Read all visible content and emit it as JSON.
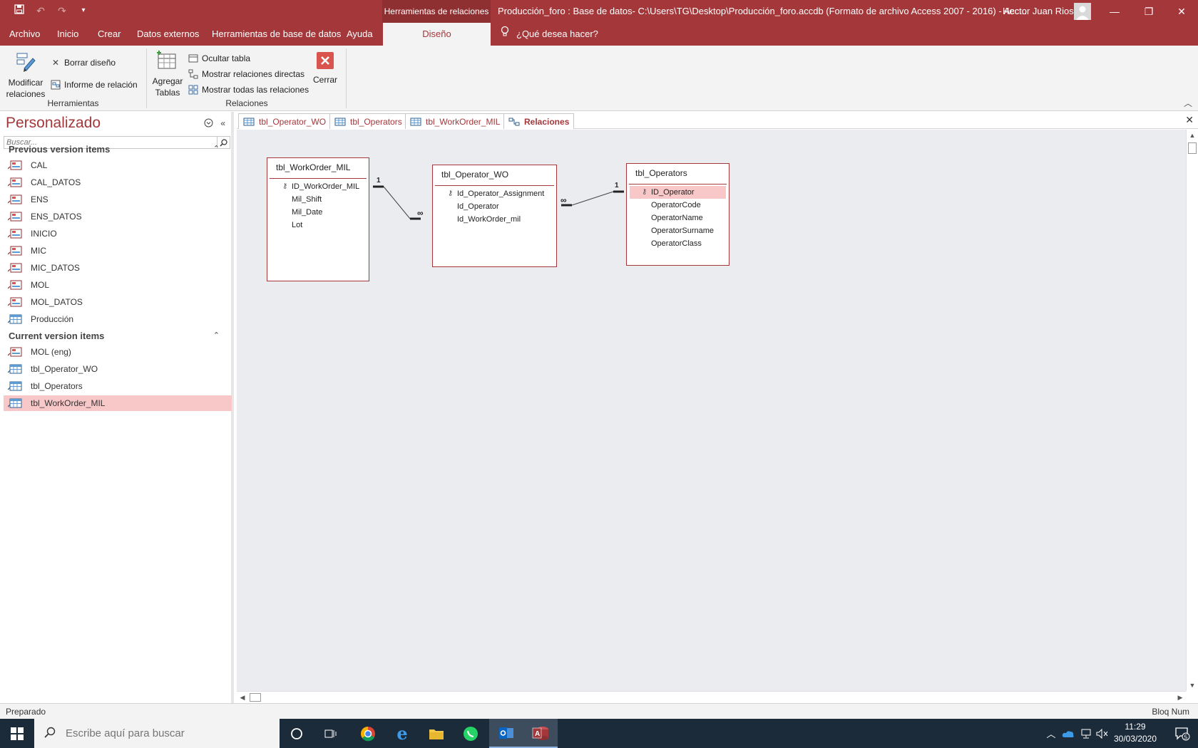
{
  "window": {
    "doc_title": "Producción_foro : Base de datos- C:\\Users\\TG\\Desktop\\Producción_foro.accdb (Formato de archivo Access 2007 - 2016)  -  Acc...",
    "context_tab_title": "Herramientas de relaciones",
    "user_name": "Hector Juan Rios",
    "accent_color": "#a4373a"
  },
  "ribbon_tabs": [
    "Archivo",
    "Inicio",
    "Crear",
    "Datos externos",
    "Herramientas de base de datos",
    "Ayuda",
    "Diseño"
  ],
  "tell_me": "¿Qué desea hacer?",
  "ribbon": {
    "herramientas": {
      "label": "Herramientas",
      "modificar_line1": "Modificar",
      "modificar_line2": "relaciones",
      "borrar": "Borrar diseño",
      "informe": "Informe de relación"
    },
    "relaciones": {
      "label": "Relaciones",
      "agregar_line1": "Agregar",
      "agregar_line2": "Tablas",
      "ocultar": "Ocultar tabla",
      "mostrar_directas": "Mostrar relaciones directas",
      "mostrar_todas": "Mostrar todas las relaciones",
      "cerrar": "Cerrar"
    }
  },
  "nav": {
    "title": "Personalizado",
    "search_placeholder": "Buscar...",
    "sections": [
      {
        "title": "Previous version items",
        "items": [
          {
            "label": "CAL",
            "type": "form"
          },
          {
            "label": "CAL_DATOS",
            "type": "form"
          },
          {
            "label": "ENS",
            "type": "form"
          },
          {
            "label": "ENS_DATOS",
            "type": "form"
          },
          {
            "label": "INICIO",
            "type": "form"
          },
          {
            "label": "MIC",
            "type": "form"
          },
          {
            "label": "MIC_DATOS",
            "type": "form"
          },
          {
            "label": "MOL",
            "type": "form"
          },
          {
            "label": "MOL_DATOS",
            "type": "form"
          },
          {
            "label": "Producción",
            "type": "table"
          }
        ]
      },
      {
        "title": "Current version items",
        "items": [
          {
            "label": "MOL (eng)",
            "type": "form"
          },
          {
            "label": "tbl_Operator_WO",
            "type": "table"
          },
          {
            "label": "tbl_Operators",
            "type": "table"
          },
          {
            "label": "tbl_WorkOrder_MIL",
            "type": "table",
            "selected": true
          }
        ]
      }
    ]
  },
  "doc_tabs": [
    {
      "label": "tbl_Operator_WO",
      "active": false
    },
    {
      "label": "tbl_Operators",
      "active": false
    },
    {
      "label": "tbl_WorkOrder_MIL",
      "active": false
    },
    {
      "label": "Relaciones",
      "active": true
    }
  ],
  "tables": {
    "workorder": {
      "name": "tbl_WorkOrder_MIL",
      "fields": [
        {
          "label": "ID_WorkOrder_MIL",
          "key": true
        },
        {
          "label": "Mil_Shift"
        },
        {
          "label": "Mil_Date"
        },
        {
          "label": "Lot"
        }
      ]
    },
    "operator_wo": {
      "name": "tbl_Operator_WO",
      "fields": [
        {
          "label": "Id_Operator_Assignment",
          "key": true
        },
        {
          "label": "Id_Operator"
        },
        {
          "label": "Id_WorkOrder_mil"
        }
      ]
    },
    "operators": {
      "name": "tbl_Operators",
      "fields": [
        {
          "label": "ID_Operator",
          "key": true,
          "selected": true
        },
        {
          "label": "OperatorCode"
        },
        {
          "label": "OperatorName"
        },
        {
          "label": "OperatorSurname"
        },
        {
          "label": "OperatorClass"
        }
      ]
    }
  },
  "relationships": {
    "one_label": "1",
    "many_label": "∞"
  },
  "status": {
    "left": "Preparado",
    "right": "Bloq Num"
  },
  "taskbar": {
    "search_placeholder": "Escribe aquí para buscar",
    "time": "11:29",
    "date": "30/03/2020",
    "notifications": "5"
  }
}
